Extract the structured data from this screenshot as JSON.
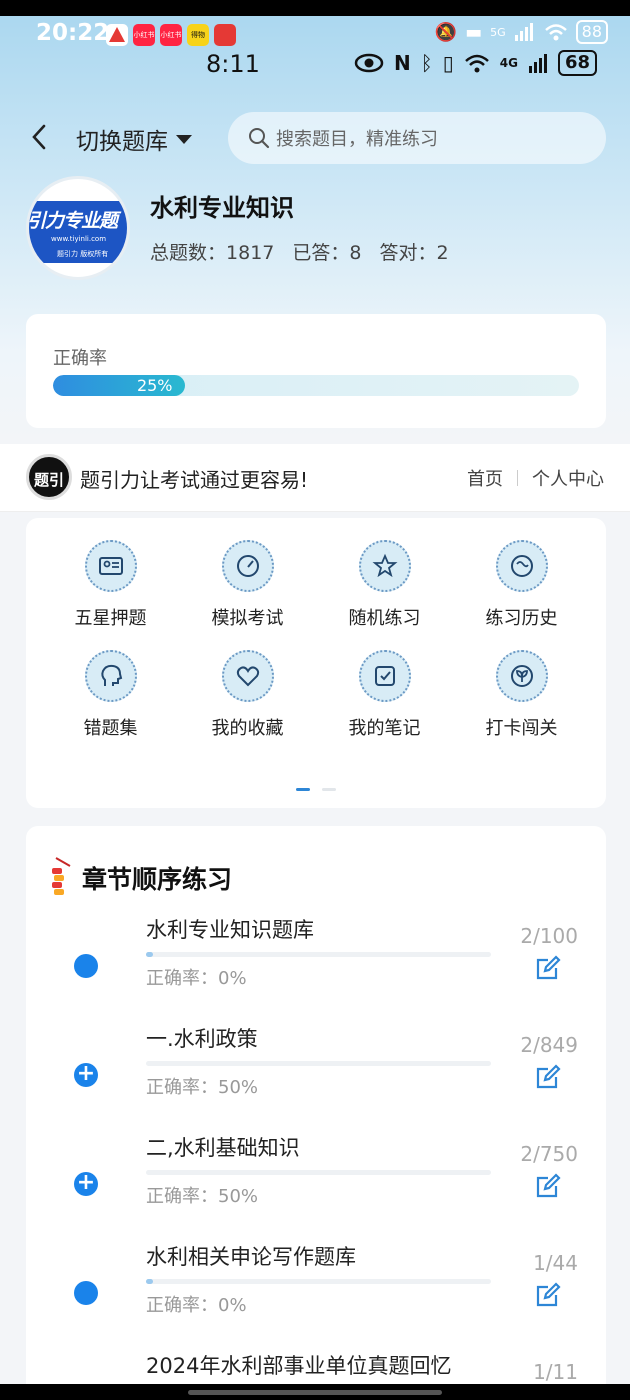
{
  "status_outer": {
    "time": "20:22",
    "apps": [
      "",
      "小红书",
      "小红书",
      "得物",
      ""
    ],
    "network": "5G",
    "battery": "88"
  },
  "status_inner": {
    "time": "8:11",
    "network": "4G",
    "battery": "68"
  },
  "topbar": {
    "switch_label": "切换题库",
    "search_placeholder": "搜索题目，精准练习"
  },
  "bank": {
    "logo_text": "引力专业题",
    "logo_url": "www.tiyinli.com",
    "logo_copyright": "题引力 版权所有",
    "name": "水利专业知识",
    "total_label": "总题数：",
    "total": "1817",
    "answered_label": "已答：",
    "answered": "8",
    "correct_label": "答对：",
    "correct": "2"
  },
  "accuracy": {
    "label": "正确率",
    "value_text": "25%",
    "value": 0.25
  },
  "promo": {
    "logo_text": "题引力",
    "slogan": "题引力让考试通过更容易!",
    "home_link": "首页",
    "profile_link": "个人中心"
  },
  "features": [
    {
      "label": "五星押题",
      "icon": "id-card-icon"
    },
    {
      "label": "模拟考试",
      "icon": "speedometer-icon"
    },
    {
      "label": "随机练习",
      "icon": "shuffle-star-icon"
    },
    {
      "label": "练习历史",
      "icon": "history-icon"
    },
    {
      "label": "错题集",
      "icon": "brain-head-icon"
    },
    {
      "label": "我的收藏",
      "icon": "heart-icon"
    },
    {
      "label": "我的笔记",
      "icon": "note-check-icon"
    },
    {
      "label": "打卡闯关",
      "icon": "sprout-icon"
    }
  ],
  "chapters": {
    "title": "章节顺序练习",
    "items": [
      {
        "name": "水利专业知识题库",
        "accuracy": "正确率：0%",
        "count": "2/100",
        "progress": 0.02,
        "expandable": false
      },
      {
        "name": "一.水利政策",
        "accuracy": "正确率：50%",
        "count": "2/849",
        "progress": 0.0,
        "expandable": true
      },
      {
        "name": "二,水利基础知识",
        "accuracy": "正确率：50%",
        "count": "2/750",
        "progress": 0.0,
        "expandable": true
      },
      {
        "name": "水利相关申论写作题库",
        "accuracy": "正确率：0%",
        "count": "1/44",
        "progress": 0.02,
        "expandable": false
      },
      {
        "name": "2024年水利部事业单位真题回忆",
        "accuracy": "",
        "count": "1/11",
        "progress": 0.0,
        "expandable": false
      }
    ]
  },
  "colors": {
    "accent": "#1a83ea",
    "progress_start": "#2f8de0",
    "progress_end": "#29b9d0"
  }
}
